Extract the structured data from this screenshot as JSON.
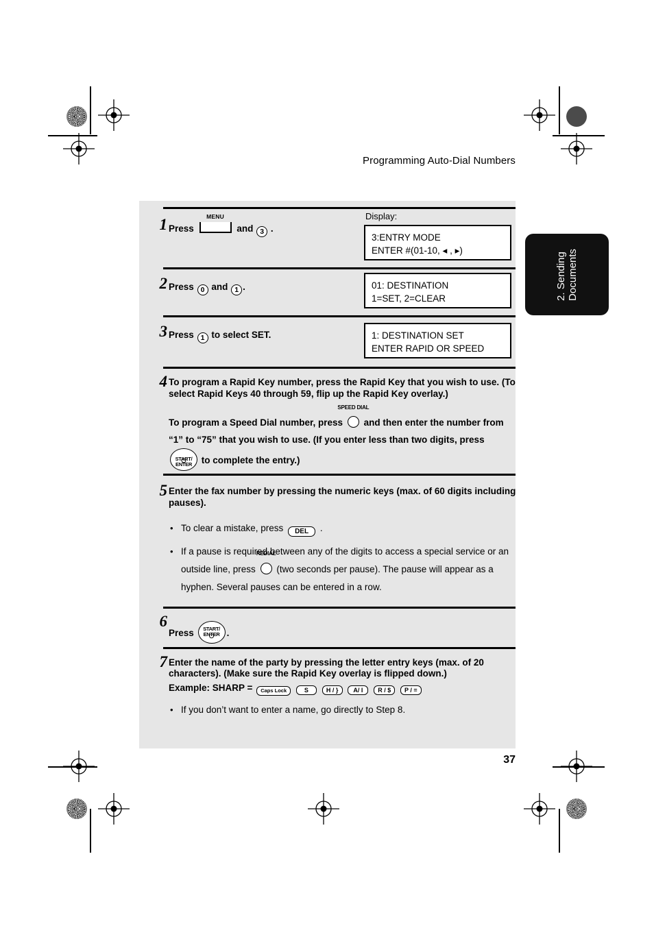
{
  "page": {
    "running_head": "Programming Auto-Dial Numbers",
    "page_number": "37",
    "thumb_tab": "2. Sending\nDocuments",
    "panel_bg": "#e6e6e6",
    "tab_bg": "#111111"
  },
  "display_label": "Display:",
  "steps": [
    {
      "number": "1",
      "text_lead": "Press",
      "text_mid": "and",
      "text_tail": ".",
      "key_menu": "MENU",
      "key_num": "3",
      "display": "3:ENTRY MODE\nENTER #(01-10, ◂ , ▸)"
    },
    {
      "number": "2",
      "text_lead": "Press",
      "text_mid": "and",
      "text_tail": ".",
      "key_num_a": "0",
      "key_num_b": "1",
      "display": "01: DESTINATION\n1=SET, 2=CLEAR"
    },
    {
      "number": "3",
      "text_lead": "Press",
      "text_tail": "to select SET.",
      "key_num": "1",
      "display": "1: DESTINATION SET\nENTER RAPID OR SPEED"
    },
    {
      "number": "4",
      "para1": "To program a Rapid Key number, press the Rapid Key that you wish to use. (To select Rapid Keys 40 through 59, flip up the Rapid Key overlay.)",
      "para2_a": "To program a Speed Dial number, press",
      "para2_b": "and then enter the number from “1” to “75” that you wish to use. (If you enter less than two digits, press",
      "para2_c": "to complete the entry.)",
      "key_speed_dial": "SPEED DIAL",
      "key_start_l1": "START/",
      "key_start_l2": "ENTER",
      "key_start_power": "⏻"
    },
    {
      "number": "5",
      "para1": "Enter the fax number by pressing the numeric keys (max. of 60 digits including pauses).",
      "bullet1_a": "To clear a mistake, press",
      "bullet1_b": ".",
      "key_del": "DEL",
      "bullet2_a": "If a pause is required between any of the digits to access a special service or an outside line, press",
      "bullet2_b": "(two seconds per pause). The pause will appear as a hyphen. Several pauses can be entered in a row.",
      "key_redial": "REDIAL"
    },
    {
      "number": "6",
      "text_lead": "Press",
      "text_tail": ".",
      "key_start_l1": "START/",
      "key_start_l2": "ENTER",
      "key_start_power": "⏻"
    },
    {
      "number": "7",
      "para1": "Enter the name of the party by pressing the letter entry keys (max. of 20 characters). (Make sure the Rapid Key overlay is flipped down.)",
      "example_label": "Example: SHARP =",
      "example_keys": [
        "Caps Lock",
        "S",
        "H / }",
        "A/ I",
        "R / $",
        "P / ="
      ],
      "bullet1": "If you don’t want to enter a name, go directly to Step 8."
    }
  ]
}
